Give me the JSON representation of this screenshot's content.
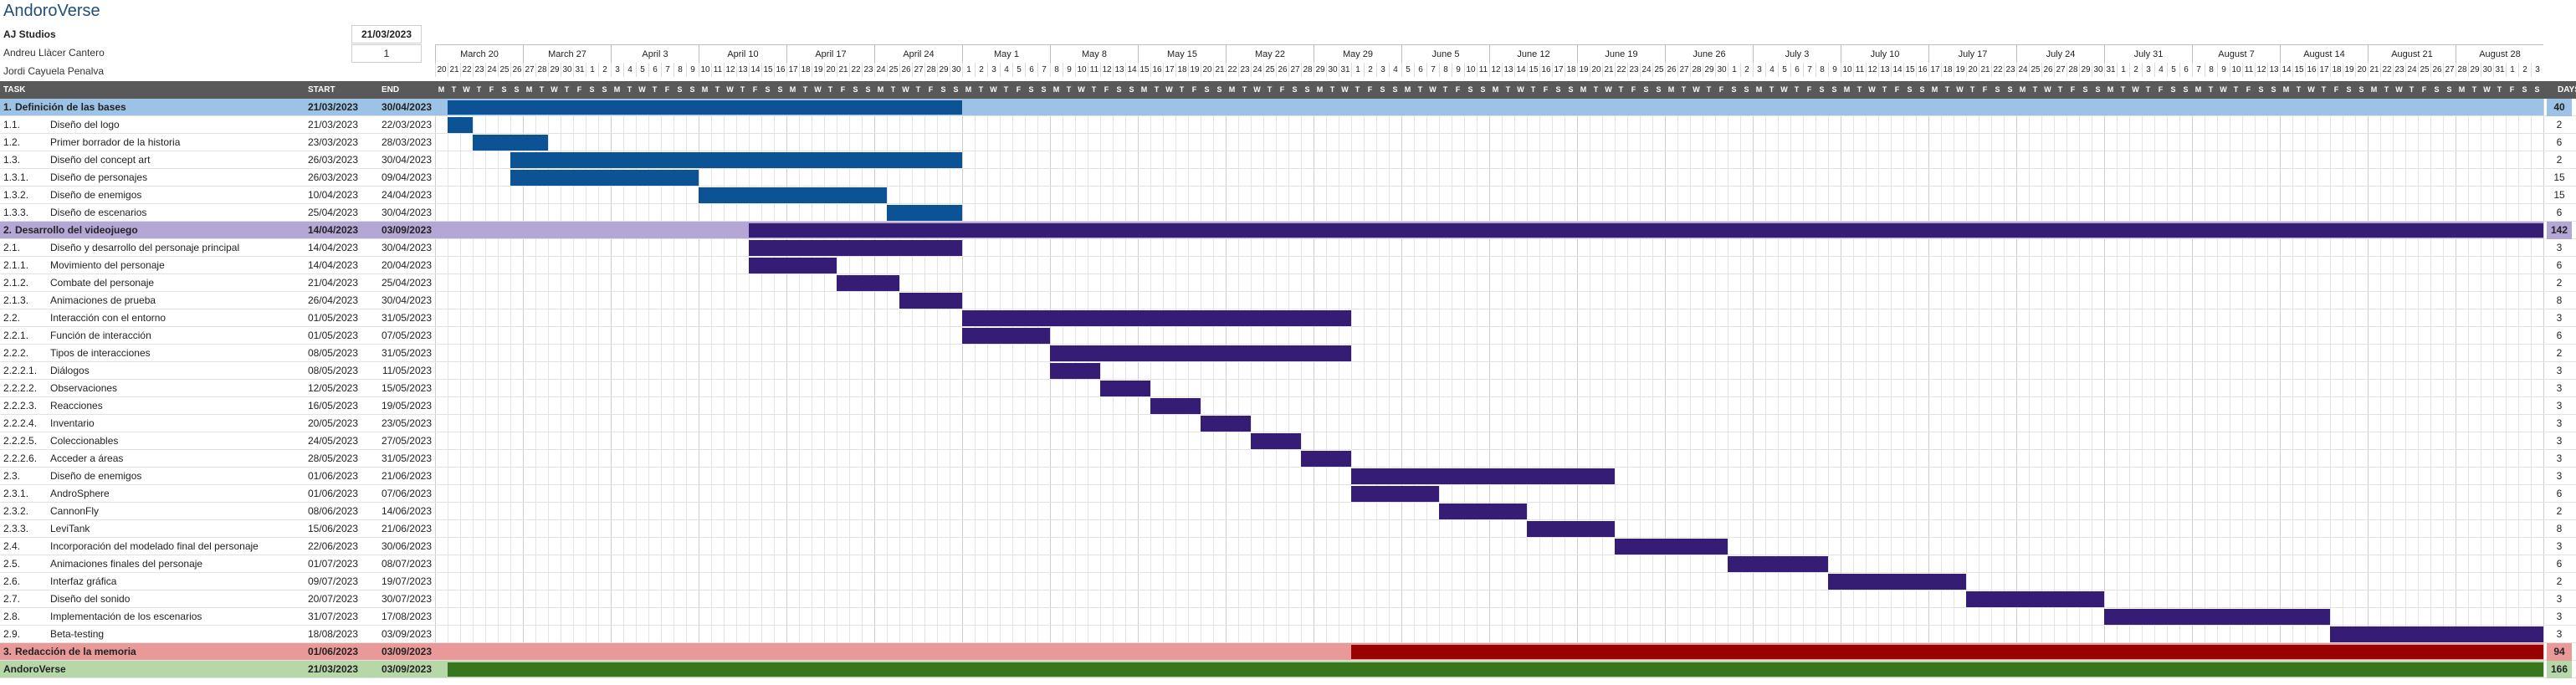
{
  "header": {
    "title": "AndoroVerse",
    "company": "AJ Studios",
    "members": [
      "Andreu Llàcer Cantero",
      "Jordi Cayuela Penalva"
    ],
    "start_date": "21/03/2023",
    "display_week": "1"
  },
  "columns": {
    "task": "TASK",
    "start": "START",
    "end": "END",
    "days": "DAYS"
  },
  "colors": {
    "header_bg": "#595959",
    "group_blue": "#9cc3e5",
    "group_purple": "#b4a7d6",
    "group_red": "#ea9999",
    "group_green": "#b6d7a8",
    "bar_blue": "#0b5394",
    "bar_purple": "#351c75",
    "bar_red": "#990000",
    "bar_green": "#38761d"
  },
  "weeks": [
    "March 20",
    "March 27",
    "April 3",
    "April 10",
    "April 17",
    "April 24",
    "May 1",
    "May 8",
    "May 15",
    "May 22",
    "May 29",
    "June 5",
    "June 12",
    "June 19",
    "June 26",
    "July 3",
    "July 10",
    "July 17",
    "July 24",
    "July 31",
    "August 7",
    "August 14",
    "August 21",
    "August 28"
  ],
  "day_numbers": [
    "20",
    "21",
    "22",
    "23",
    "24",
    "25",
    "26",
    "27",
    "28",
    "29",
    "30",
    "31",
    "1",
    "2",
    "3",
    "4",
    "5",
    "6",
    "7",
    "8",
    "9",
    "10",
    "11",
    "12",
    "13",
    "14",
    "15",
    "16",
    "17",
    "18",
    "19",
    "20",
    "21",
    "22",
    "23",
    "24",
    "25",
    "26",
    "27",
    "28",
    "29",
    "30",
    "1",
    "2",
    "3",
    "4",
    "5",
    "6",
    "7",
    "8",
    "9",
    "10",
    "11",
    "12",
    "13",
    "14",
    "15",
    "16",
    "17",
    "18",
    "19",
    "20",
    "21",
    "22",
    "23",
    "24",
    "25",
    "26",
    "27",
    "28",
    "29",
    "30",
    "31",
    "1",
    "2",
    "3",
    "4",
    "5",
    "6",
    "7",
    "8",
    "9",
    "10",
    "11",
    "12",
    "13",
    "14",
    "15",
    "16",
    "17",
    "18",
    "19",
    "20",
    "21",
    "22",
    "23",
    "24",
    "25",
    "26",
    "27",
    "28",
    "29",
    "30",
    "1",
    "2",
    "3",
    "4",
    "5",
    "6",
    "7",
    "8",
    "9",
    "10",
    "11",
    "12",
    "13",
    "14",
    "15",
    "16",
    "17",
    "18",
    "19",
    "20",
    "21",
    "22",
    "23",
    "24",
    "25",
    "26",
    "27",
    "28",
    "29",
    "30",
    "31",
    "1",
    "2",
    "3",
    "4",
    "5",
    "6",
    "7",
    "8",
    "9",
    "10",
    "11",
    "12",
    "13",
    "14",
    "15",
    "16",
    "17",
    "18",
    "19",
    "20",
    "21",
    "22",
    "23",
    "24",
    "25",
    "26",
    "27",
    "28",
    "29",
    "30",
    "31",
    "1",
    "2",
    "3"
  ],
  "day_letters": [
    "M",
    "T",
    "W",
    "T",
    "F",
    "S",
    "S"
  ],
  "chart_data": {
    "type": "gantt",
    "timeline_start": "2023-03-20",
    "timeline_end": "2023-09-03",
    "tasks": [
      {
        "id": "1.",
        "name": "Definición de las bases",
        "start": "21/03/2023",
        "end": "30/04/2023",
        "days": "40",
        "level": "group",
        "color": "blue"
      },
      {
        "id": "1.1.",
        "name": "Diseño del logo",
        "start": "21/03/2023",
        "end": "22/03/2023",
        "days": "2",
        "level": "task",
        "color": "blue"
      },
      {
        "id": "1.2.",
        "name": "Primer borrador de la historia",
        "start": "23/03/2023",
        "end": "28/03/2023",
        "days": "6",
        "level": "task",
        "color": "blue"
      },
      {
        "id": "1.3.",
        "name": "Diseño del concept art",
        "start": "26/03/2023",
        "end": "30/04/2023",
        "days": "2",
        "level": "task",
        "color": "blue"
      },
      {
        "id": "1.3.1.",
        "name": "Diseño de personajes",
        "start": "26/03/2023",
        "end": "09/04/2023",
        "days": "15",
        "level": "task",
        "color": "blue"
      },
      {
        "id": "1.3.2.",
        "name": "Diseño de enemigos",
        "start": "10/04/2023",
        "end": "24/04/2023",
        "days": "15",
        "level": "task",
        "color": "blue"
      },
      {
        "id": "1.3.3.",
        "name": "Diseño de escenarios",
        "start": "25/04/2023",
        "end": "30/04/2023",
        "days": "6",
        "level": "task",
        "color": "blue"
      },
      {
        "id": "2.",
        "name": "Desarrollo del videojuego",
        "start": "14/04/2023",
        "end": "03/09/2023",
        "days": "142",
        "level": "group",
        "color": "purple"
      },
      {
        "id": "2.1.",
        "name": "Diseño y desarrollo del personaje principal",
        "start": "14/04/2023",
        "end": "30/04/2023",
        "days": "3",
        "level": "task",
        "color": "purple"
      },
      {
        "id": "2.1.1.",
        "name": "Movimiento del personaje",
        "start": "14/04/2023",
        "end": "20/04/2023",
        "days": "6",
        "level": "task",
        "color": "purple"
      },
      {
        "id": "2.1.2.",
        "name": "Combate del personaje",
        "start": "21/04/2023",
        "end": "25/04/2023",
        "days": "2",
        "level": "task",
        "color": "purple"
      },
      {
        "id": "2.1.3.",
        "name": "Animaciones de prueba",
        "start": "26/04/2023",
        "end": "30/04/2023",
        "days": "8",
        "level": "task",
        "color": "purple"
      },
      {
        "id": "2.2.",
        "name": "Interacción con el entorno",
        "start": "01/05/2023",
        "end": "31/05/2023",
        "days": "3",
        "level": "task",
        "color": "purple"
      },
      {
        "id": "2.2.1.",
        "name": "Función de interacción",
        "start": "01/05/2023",
        "end": "07/05/2023",
        "days": "6",
        "level": "task",
        "color": "purple"
      },
      {
        "id": "2.2.2.",
        "name": "Tipos de interacciones",
        "start": "08/05/2023",
        "end": "31/05/2023",
        "days": "2",
        "level": "task",
        "color": "purple"
      },
      {
        "id": "2.2.2.1.",
        "name": "Diálogos",
        "start": "08/05/2023",
        "end": "11/05/2023",
        "days": "3",
        "level": "task",
        "color": "purple"
      },
      {
        "id": "2.2.2.2.",
        "name": "Observaciones",
        "start": "12/05/2023",
        "end": "15/05/2023",
        "days": "3",
        "level": "task",
        "color": "purple"
      },
      {
        "id": "2.2.2.3.",
        "name": "Reacciones",
        "start": "16/05/2023",
        "end": "19/05/2023",
        "days": "3",
        "level": "task",
        "color": "purple"
      },
      {
        "id": "2.2.2.4.",
        "name": "Inventario",
        "start": "20/05/2023",
        "end": "23/05/2023",
        "days": "3",
        "level": "task",
        "color": "purple"
      },
      {
        "id": "2.2.2.5.",
        "name": "Coleccionables",
        "start": "24/05/2023",
        "end": "27/05/2023",
        "days": "3",
        "level": "task",
        "color": "purple"
      },
      {
        "id": "2.2.2.6.",
        "name": "Acceder a áreas",
        "start": "28/05/2023",
        "end": "31/05/2023",
        "days": "3",
        "level": "task",
        "color": "purple"
      },
      {
        "id": "2.3.",
        "name": "Diseño de enemigos",
        "start": "01/06/2023",
        "end": "21/06/2023",
        "days": "3",
        "level": "task",
        "color": "purple"
      },
      {
        "id": "2.3.1.",
        "name": "AndroSphere",
        "start": "01/06/2023",
        "end": "07/06/2023",
        "days": "6",
        "level": "task",
        "color": "purple"
      },
      {
        "id": "2.3.2.",
        "name": "CannonFly",
        "start": "08/06/2023",
        "end": "14/06/2023",
        "days": "2",
        "level": "task",
        "color": "purple"
      },
      {
        "id": "2.3.3.",
        "name": "LeviTank",
        "start": "15/06/2023",
        "end": "21/06/2023",
        "days": "8",
        "level": "task",
        "color": "purple"
      },
      {
        "id": "2.4.",
        "name": "Incorporación del modelado final del personaje",
        "start": "22/06/2023",
        "end": "30/06/2023",
        "days": "3",
        "level": "task",
        "color": "purple"
      },
      {
        "id": "2.5.",
        "name": "Animaciones finales del personaje",
        "start": "01/07/2023",
        "end": "08/07/2023",
        "days": "6",
        "level": "task",
        "color": "purple"
      },
      {
        "id": "2.6.",
        "name": "Interfaz gráfica",
        "start": "09/07/2023",
        "end": "19/07/2023",
        "days": "2",
        "level": "task",
        "color": "purple"
      },
      {
        "id": "2.7.",
        "name": "Diseño del sonido",
        "start": "20/07/2023",
        "end": "30/07/2023",
        "days": "3",
        "level": "task",
        "color": "purple"
      },
      {
        "id": "2.8.",
        "name": "Implementación de los escenarios",
        "start": "31/07/2023",
        "end": "17/08/2023",
        "days": "3",
        "level": "task",
        "color": "purple"
      },
      {
        "id": "2.9.",
        "name": "Beta-testing",
        "start": "18/08/2023",
        "end": "03/09/2023",
        "days": "3",
        "level": "task",
        "color": "purple"
      },
      {
        "id": "3.",
        "name": "Redacción de la memoria",
        "start": "01/06/2023",
        "end": "03/09/2023",
        "days": "94",
        "level": "group",
        "color": "red"
      },
      {
        "id": "",
        "name": "AndoroVerse",
        "start": "21/03/2023",
        "end": "03/09/2023",
        "days": "166",
        "level": "total",
        "color": "green"
      }
    ]
  }
}
